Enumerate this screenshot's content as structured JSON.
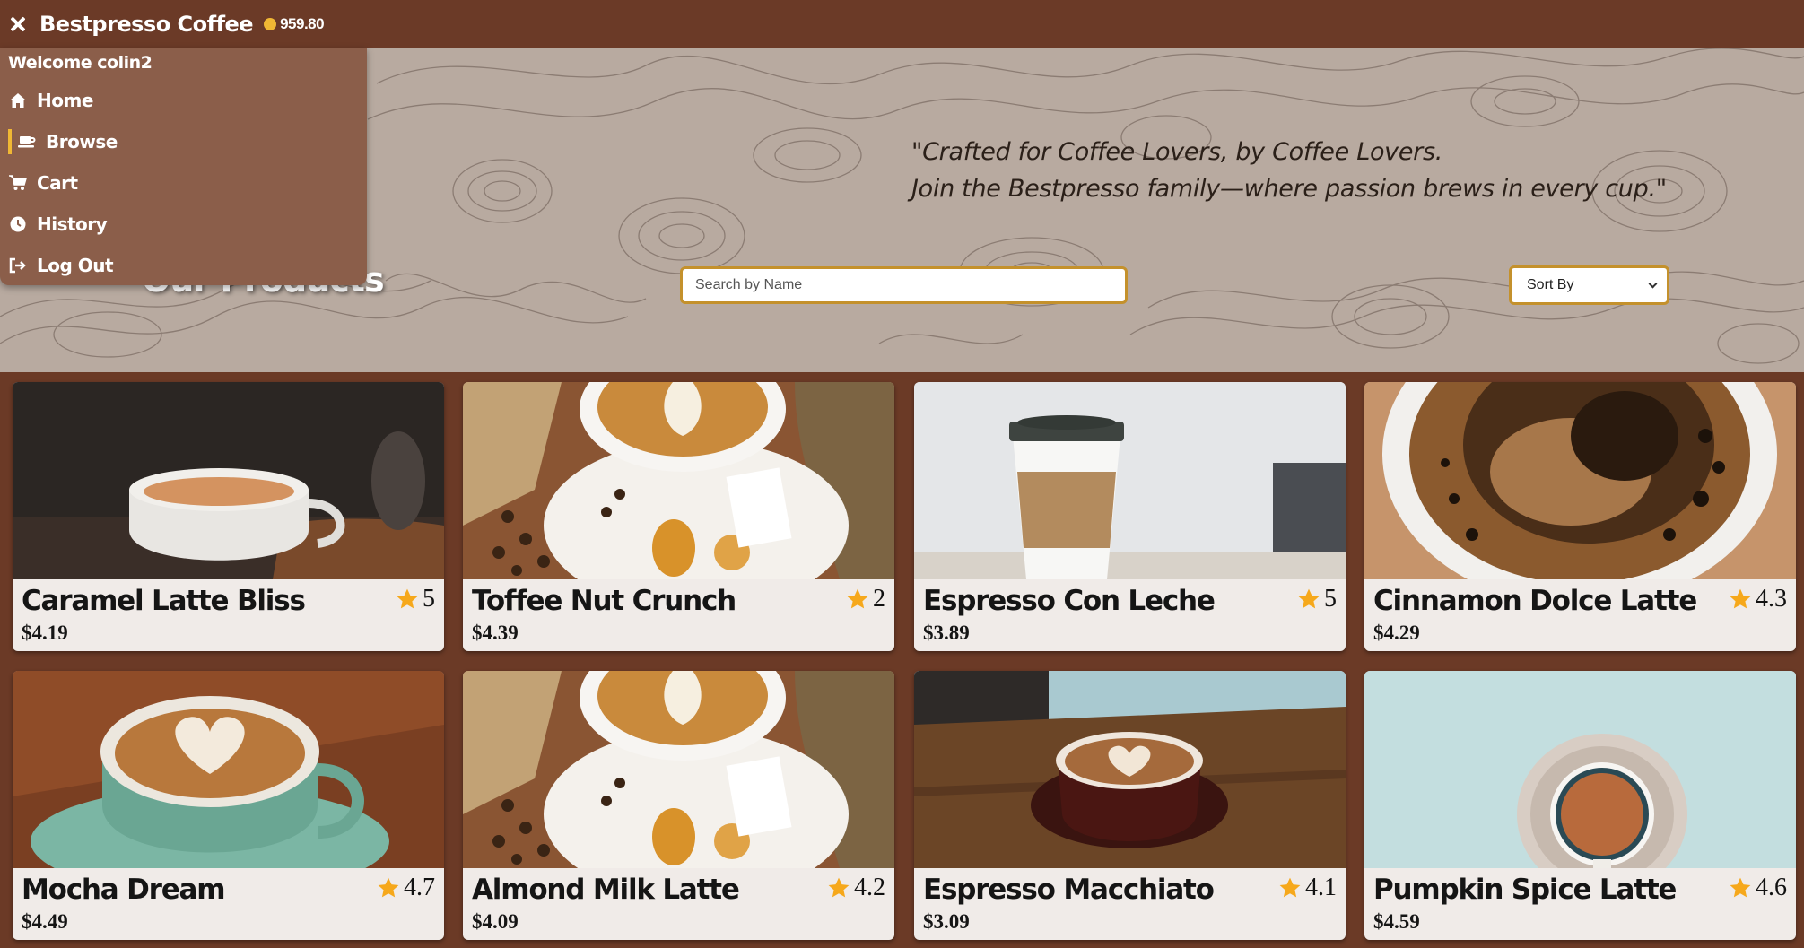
{
  "header": {
    "brand": "Bestpresso Coffee",
    "balance": "959.80",
    "close_icon": "close-icon",
    "coin_icon": "coin-icon"
  },
  "menu": {
    "welcome": "Welcome colin2",
    "items": [
      {
        "label": "Home",
        "icon": "home-icon"
      },
      {
        "label": "Browse",
        "icon": "coffee-cup-icon",
        "active": true
      },
      {
        "label": "Cart",
        "icon": "cart-icon"
      },
      {
        "label": "History",
        "icon": "clock-icon"
      },
      {
        "label": "Log Out",
        "icon": "logout-icon"
      }
    ]
  },
  "hero": {
    "quote_line1": "\"Crafted for Coffee Lovers, by Coffee Lovers.",
    "quote_line2": "Join the Bestpresso family—where passion brews in every cup.\"",
    "products_title": "Our Products"
  },
  "search": {
    "placeholder": "Search by Name"
  },
  "sort": {
    "label": "Sort By"
  },
  "colors": {
    "topbar": "#6b3a27",
    "menu": "#8b5e4a",
    "accent": "#f1b834",
    "card": "#f0ebe8",
    "input_border": "#c4912c"
  },
  "products": [
    {
      "name": "Caramel Latte Bliss",
      "rating": "5",
      "price": "$4.19"
    },
    {
      "name": "Toffee Nut Crunch",
      "rating": "2",
      "price": "$4.39"
    },
    {
      "name": "Espresso Con Leche",
      "rating": "5",
      "price": "$3.89"
    },
    {
      "name": "Cinnamon Dolce Latte",
      "rating": "4.3",
      "price": "$4.29"
    },
    {
      "name": "Mocha Dream",
      "rating": "4.7",
      "price": "$4.49"
    },
    {
      "name": "Almond Milk Latte",
      "rating": "4.2",
      "price": "$4.09"
    },
    {
      "name": "Espresso Macchiato",
      "rating": "4.1",
      "price": "$3.09"
    },
    {
      "name": "Pumpkin Spice Latte",
      "rating": "4.6",
      "price": "$4.59"
    }
  ]
}
